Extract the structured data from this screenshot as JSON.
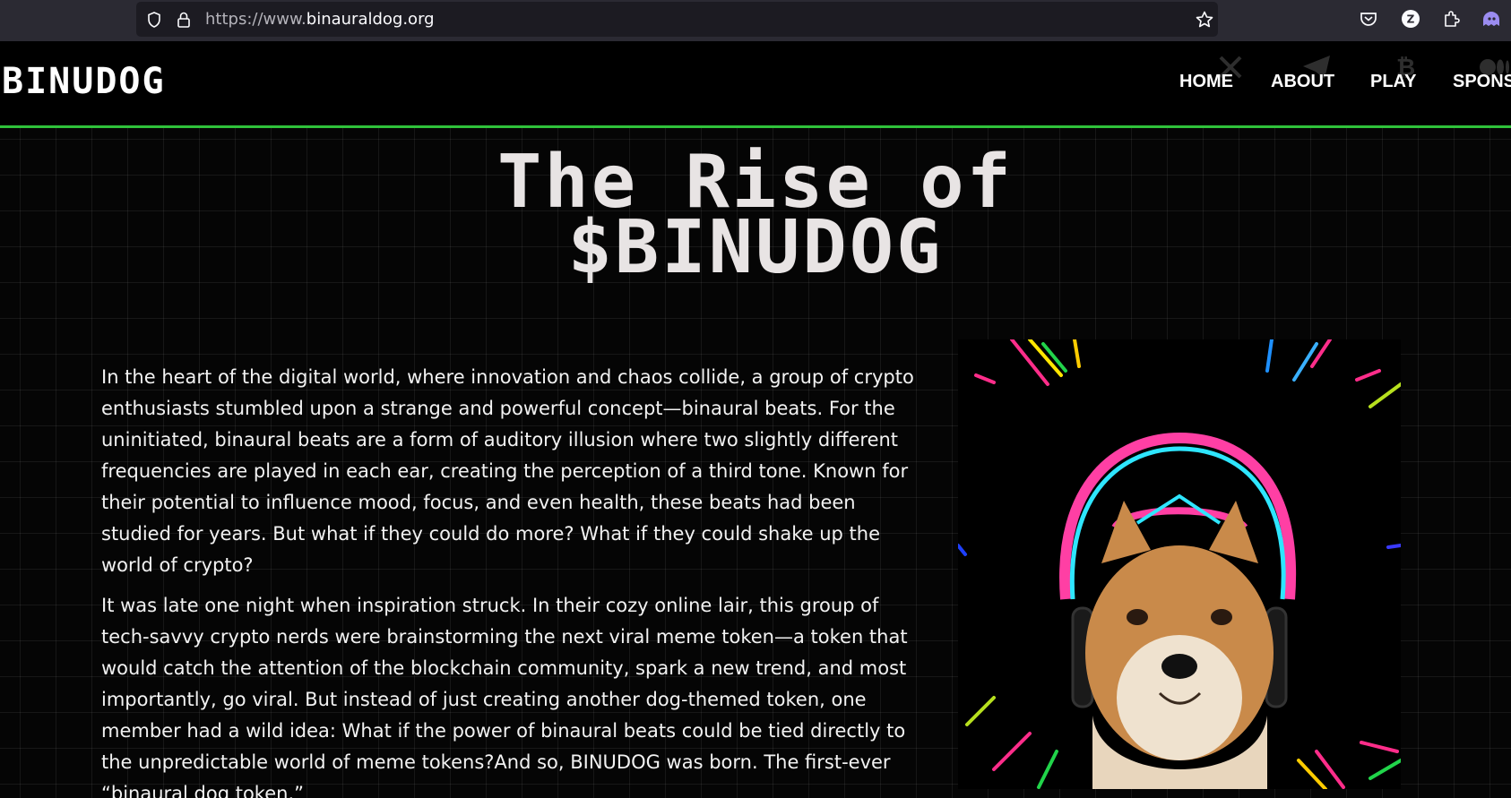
{
  "browser": {
    "url_prefix": "https://www.",
    "url_domain": "binauraldog.org",
    "icons": [
      "shield-icon",
      "lock-icon",
      "bookmark-star-icon",
      "pocket-icon",
      "profile-icon",
      "extensions-icon",
      "extension-ghost-icon"
    ],
    "profile_letter": "Z"
  },
  "site": {
    "logo": "BINUDOG",
    "accent_color": "#2fc23a",
    "nav": [
      {
        "label": "HOME"
      },
      {
        "label": "ABOUT"
      },
      {
        "label": "PLAY"
      },
      {
        "label": "SPONS"
      }
    ],
    "social_icons": [
      "x-icon",
      "telegram-icon",
      "bitcoin-icon",
      "medium-icon"
    ]
  },
  "hero": {
    "title_line1": "The Rise of",
    "title_line2": "$BINUDOG"
  },
  "story": {
    "paragraph1": "In the heart of the digital world, where innovation and chaos collide, a group of crypto enthusiasts stumbled upon a strange and powerful concept—binaural beats. For the uninitiated, binaural beats are a form of auditory illusion where two slightly different frequencies are played in each ear, creating the perception of a third tone. Known for their potential to influence mood, focus, and even health, these beats had been studied for years. But what if they could do more? What if they could shake up the world of crypto?",
    "paragraph2": "It was late one night when inspiration struck. In their cozy online lair, this group of tech-savvy crypto nerds were brainstorming the next viral meme token—a token that would catch the attention of the blockchain community, spark a new trend, and most importantly, go viral. But instead of just creating another dog-themed token, one member had a wild idea: What if the power of binaural beats could be tied directly to the unpredictable world of meme tokens?And so, BINUDOG was born. The first-ever “binaural dog token.”"
  },
  "image": {
    "subject": "shiba-inu-with-headphones-icon"
  }
}
